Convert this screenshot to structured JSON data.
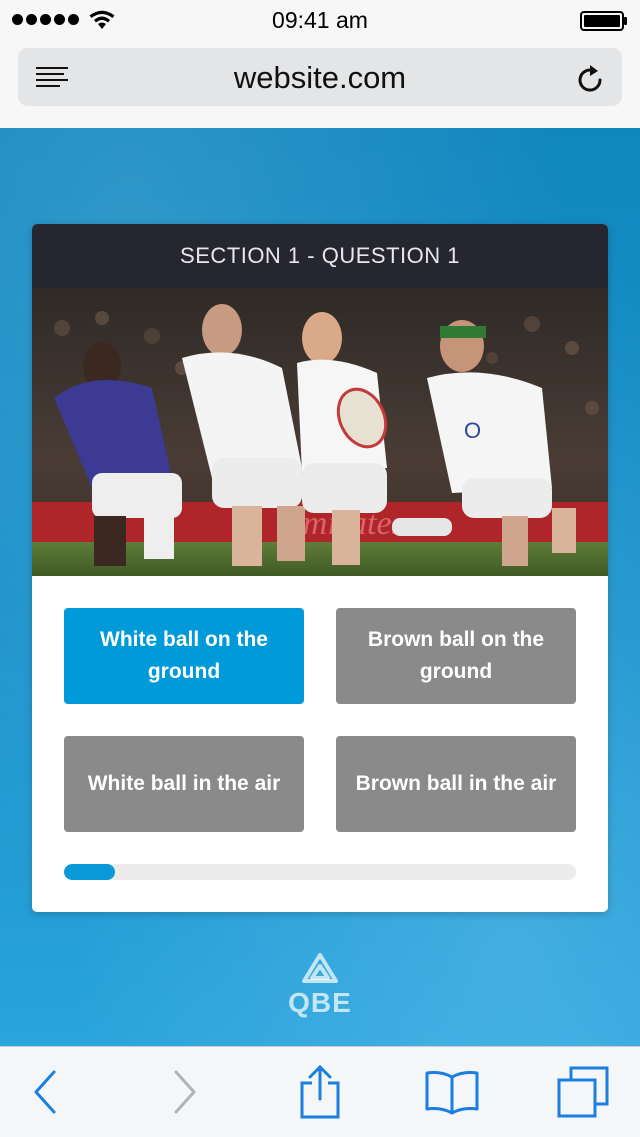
{
  "status_bar": {
    "time": "09:41 am"
  },
  "browser": {
    "url": "website.com"
  },
  "quiz": {
    "header": "SECTION 1 - QUESTION 1",
    "answers": [
      {
        "label": "White ball on the ground",
        "selected": true
      },
      {
        "label": "Brown ball on the ground",
        "selected": false
      },
      {
        "label": "White ball in the air",
        "selected": false
      },
      {
        "label": "Brown ball in the air",
        "selected": false
      }
    ],
    "progress_fraction": 0.1,
    "colors": {
      "selected": "#009ad9",
      "unselected": "#8a8a8a"
    }
  },
  "brand": {
    "logo_text": "QBE"
  },
  "toolbar": {
    "items": [
      "back-icon",
      "forward-icon",
      "share-icon",
      "bookmarks-icon",
      "tabs-icon"
    ]
  }
}
